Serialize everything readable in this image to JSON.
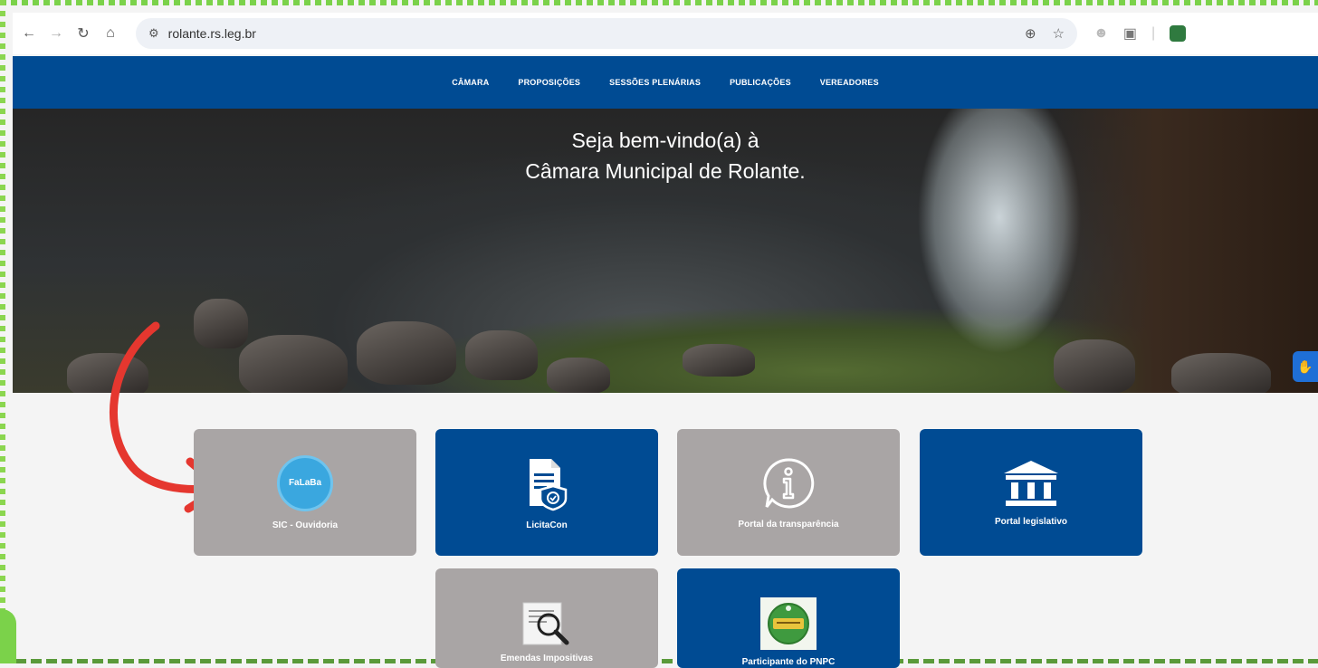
{
  "browser": {
    "url": "rolante.rs.leg.br",
    "nav_icons": [
      "back-icon",
      "forward-icon",
      "reload-icon",
      "home-icon"
    ],
    "url_icons": [
      "zoom-icon",
      "star-icon"
    ],
    "toolbar_icons": [
      "profile-icon",
      "extensions-icon",
      "extension-app-icon"
    ]
  },
  "nav": {
    "items": [
      "CÂMARA",
      "PROPOSIÇÕES",
      "SESSÕES PLENÁRIAS",
      "PUBLICAÇÕES",
      "VEREADORES"
    ]
  },
  "hero": {
    "line1": "Seja bem-vindo(a) à",
    "line2": "Câmara Municipal de Rolante."
  },
  "cards": [
    {
      "label": "SIC - Ouvidoria",
      "icon_text": "FaLaBa"
    },
    {
      "label": "LicitaCon"
    },
    {
      "label": "Portal da transparência"
    },
    {
      "label": "Portal legislativo"
    },
    {
      "label": "Emendas Impositivas"
    },
    {
      "label": "Participante do PNPC"
    }
  ],
  "colors": {
    "brand_blue": "#004b93",
    "card_gray": "#a9a5a5",
    "arrow_red": "#e5372f",
    "frame_green": "#7bd24a"
  }
}
